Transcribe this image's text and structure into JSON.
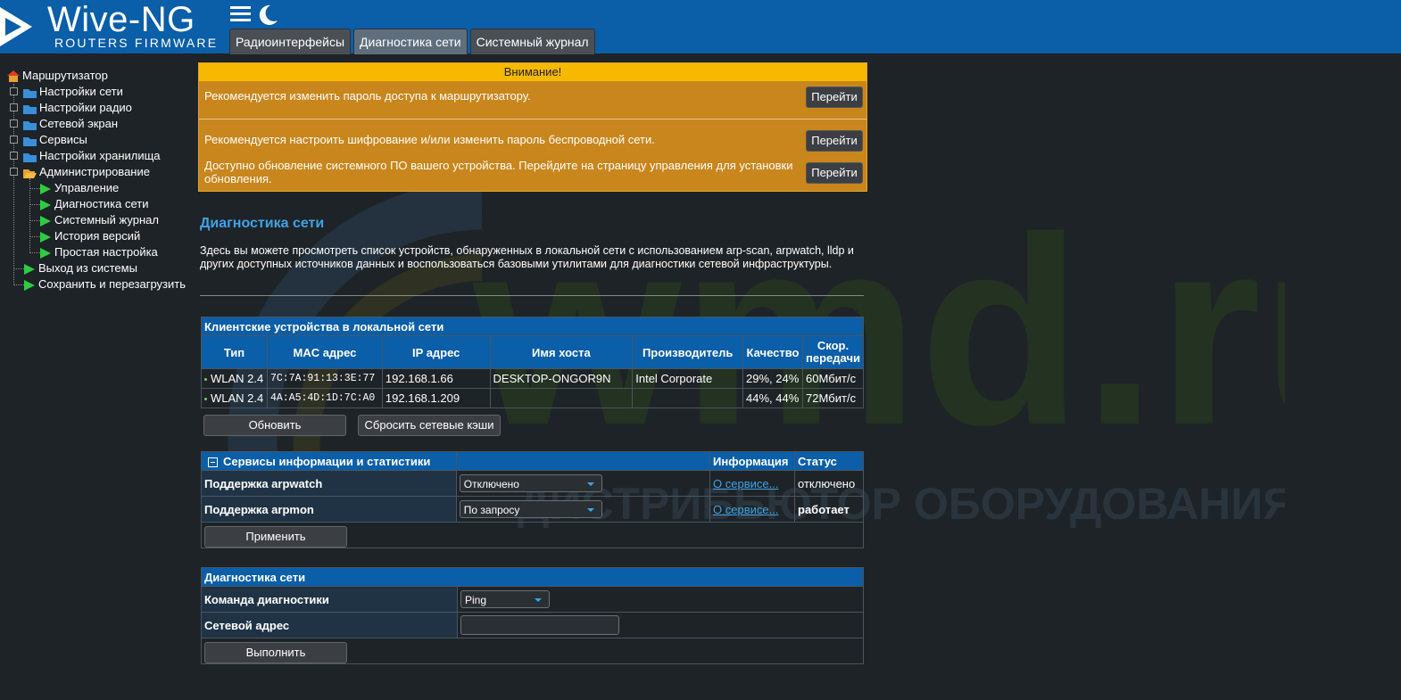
{
  "header": {
    "logo_title": "Wive-NG",
    "logo_subtitle": "ROUTERS FIRMWARE",
    "tabs": [
      {
        "label": "Радиоинтерфейсы"
      },
      {
        "label": "Диагностика сети"
      },
      {
        "label": "Системный журнал"
      }
    ]
  },
  "sidebar": {
    "root": "Маршрутизатор",
    "items": [
      {
        "label": "Настройки сети"
      },
      {
        "label": "Настройки радио"
      },
      {
        "label": "Сетевой экран"
      },
      {
        "label": "Сервисы"
      },
      {
        "label": "Настройки хранилища"
      },
      {
        "label": "Администрирование"
      }
    ],
    "admin_items": [
      {
        "label": "Управление"
      },
      {
        "label": "Диагностика сети"
      },
      {
        "label": "Системный журнал"
      },
      {
        "label": "История версий"
      },
      {
        "label": "Простая настройка"
      }
    ],
    "logout": "Выход из системы",
    "save_reboot": "Сохранить и перезагрузить"
  },
  "warning": {
    "title": "Внимание!",
    "rows": [
      {
        "text": "Рекомендуется изменить пароль доступа к маршрутизатору.",
        "button": "Перейти"
      },
      {
        "text": "Рекомендуется настроить шифрование и/или изменить пароль беспроводной сети.",
        "button": "Перейти"
      },
      {
        "text": "Доступно обновление системного ПО вашего устройства. Перейдите на страницу управления для установки обновления.",
        "button": "Перейти"
      }
    ]
  },
  "main": {
    "title": "Диагностика сети",
    "description": "Здесь вы можете просмотреть список устройств, обнаруженных в локальной сети с использованием arp-scan, arpwatch, lldp и других доступных источников данных и воспользоваться базовыми утилитами для диагностики сетевой инфраструктуры."
  },
  "clients": {
    "caption": "Клиентские устройства в локальной сети",
    "headers": [
      "Тип",
      "MAC адрес",
      "IP адрес",
      "Имя хоста",
      "Производитель",
      "Качество",
      "Скор. передачи"
    ],
    "rows": [
      {
        "type": "WLAN 2.4",
        "mac": "7C:7A:91:13:3E:77",
        "ip": "192.168.1.66",
        "host": "DESKTOP-ONGOR9N",
        "vendor": "Intel Corporate",
        "quality": "29%, 24%",
        "rate": "60Мбит/с"
      },
      {
        "type": "WLAN 2.4",
        "mac": "4A:A5:4D:1D:7C:A0",
        "ip": "192.168.1.209",
        "host": "",
        "vendor": "",
        "quality": "44%, 44%",
        "rate": "72Мбит/с"
      }
    ],
    "refresh_button": "Обновить",
    "flush_button": "Сбросить сетевые кэши"
  },
  "services": {
    "caption": "Сервисы информации и статистики",
    "col_info": "Информация",
    "col_status": "Статус",
    "rows": [
      {
        "label": "Поддержка arpwatch",
        "value": "Отключено",
        "link": "О сервисе...",
        "status": "отключено"
      },
      {
        "label": "Поддержка arpmon",
        "value": "По запросу",
        "link": "О сервисе...",
        "status": "работает"
      }
    ],
    "apply_button": "Применить"
  },
  "diag": {
    "caption": "Диагностика сети",
    "command_label": "Команда диагностики",
    "command_value": "Ping",
    "address_label": "Сетевой адрес",
    "address_value": "",
    "run_button": "Выполнить"
  },
  "watermark": {
    "brand": "wmd.ru",
    "tagline": "ДИСТРИБЬЮТОР ОБОРУДОВАНИЯ СВЯЗИ"
  },
  "colors": {
    "header_bg": "#0b5ea8",
    "accent": "#3fa3e8",
    "warning_bg": "#c8861c",
    "warning_title_bg": "#f7b800",
    "status_on": "#2ecc40"
  }
}
